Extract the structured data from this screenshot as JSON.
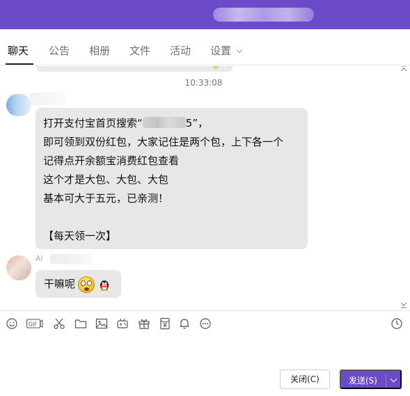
{
  "tabs": [
    {
      "label": "聊天",
      "active": true
    },
    {
      "label": "公告"
    },
    {
      "label": "相册"
    },
    {
      "label": "文件"
    },
    {
      "label": "活动"
    },
    {
      "label": "设置",
      "has_dropdown": true
    }
  ],
  "chat": {
    "timestamp": "10:33:08",
    "messages": [
      {
        "lines": [
          {
            "before": "打开支付宝首页搜索“",
            "after": "5”，"
          },
          {
            "text": "即可领到双份红包，大家记住是两个包，上下各一个"
          },
          {
            "text": "记得点开余额宝消费红包查看"
          },
          {
            "text": "这个才是大包、大包、大包"
          },
          {
            "text": "基本可大于五元，已亲测！"
          },
          {
            "text": ""
          },
          {
            "text": "【每天领一次】"
          }
        ]
      },
      {
        "sender_prefix": "Al",
        "text": "干嘛呢",
        "emojis": [
          "surprised-face-emoji",
          "qq-penguin-emoji"
        ]
      }
    ]
  },
  "toolbar": {
    "icons": [
      "emoji-icon",
      "gif-icon",
      "scissors-icon",
      "folder-icon",
      "image-icon",
      "gamepad-icon",
      "gift-icon",
      "red-packet-icon",
      "bell-icon",
      "more-icon",
      "history-icon"
    ],
    "gif_label": "GIF"
  },
  "buttons": {
    "close_label": "关闭(C)",
    "send_label": "发送(S)"
  },
  "colors": {
    "accent": "#6b4bc7",
    "bubble": "#e7e7e7"
  }
}
